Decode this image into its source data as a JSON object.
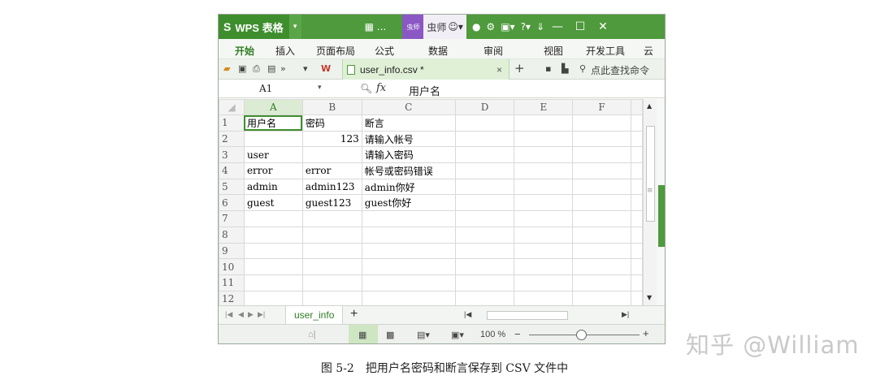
{
  "window": {
    "app_logo": "S",
    "app_name": "WPS 表格",
    "doc_name": "...",
    "user_tag": "虫师",
    "user_name": "虫师",
    "minimize": "—",
    "maximize": "☐",
    "close": "✕",
    "brand_color": "#4e9a3c"
  },
  "ribbon": {
    "tabs": [
      "开始",
      "插入",
      "页面布局",
      "公式",
      "数据",
      "审阅",
      "视图",
      "开发工具",
      "云"
    ],
    "active_tab": "开始"
  },
  "toolbar": {
    "file_tab": "user_info.csv *",
    "close_tab": "×",
    "new_tab": "+",
    "search_cmd": "点此查找命令"
  },
  "formula_bar": {
    "name_box": "A1",
    "fx": "fx",
    "value": "用户名"
  },
  "sheet": {
    "columns": [
      "A",
      "B",
      "C",
      "D",
      "E",
      "F"
    ],
    "rows": [
      {
        "n": "1",
        "a": "用户名",
        "b": "密码",
        "c": "断言"
      },
      {
        "n": "2",
        "a": "",
        "b": "123",
        "c": "请输入帐号"
      },
      {
        "n": "3",
        "a": "user",
        "b": "",
        "c": "请输入密码"
      },
      {
        "n": "4",
        "a": "error",
        "b": "error",
        "c": "帐号或密码错误"
      },
      {
        "n": "5",
        "a": "admin",
        "b": "admin123",
        "c": "admin你好"
      },
      {
        "n": "6",
        "a": "guest",
        "b": "guest123",
        "c": "guest你好"
      },
      {
        "n": "7",
        "a": "",
        "b": "",
        "c": ""
      },
      {
        "n": "8",
        "a": "",
        "b": "",
        "c": ""
      },
      {
        "n": "9",
        "a": "",
        "b": "",
        "c": ""
      },
      {
        "n": "10",
        "a": "",
        "b": "",
        "c": ""
      },
      {
        "n": "11",
        "a": "",
        "b": "",
        "c": ""
      },
      {
        "n": "12",
        "a": "",
        "b": "",
        "c": ""
      }
    ]
  },
  "sheet_tabs": {
    "active": "user_info",
    "add": "+"
  },
  "status": {
    "zoom": "100 %",
    "zoom_minus": "−",
    "zoom_plus": "+"
  },
  "caption": "图 5-2　把用户名密码和断言保存到 CSV 文件中",
  "watermark": "知乎 @William"
}
